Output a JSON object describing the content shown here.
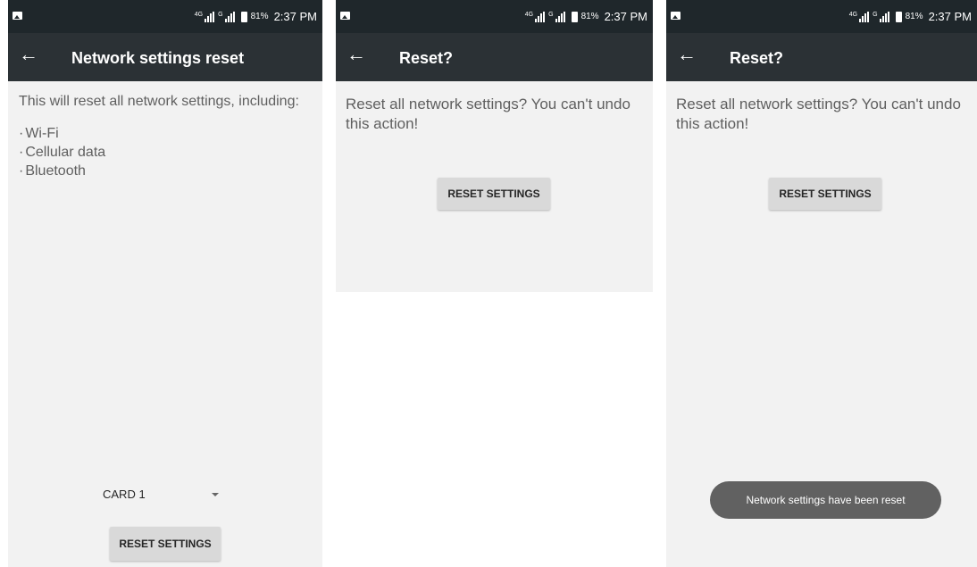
{
  "status_bar": {
    "battery_percent": "81%",
    "time": "2:37 PM",
    "signal_tag_1": "4G",
    "signal_tag_2": "G"
  },
  "screen1": {
    "title": "Network settings reset",
    "description": "This will reset all network settings, including:",
    "items": [
      "Wi-Fi",
      "Cellular data",
      "Bluetooth"
    ],
    "card_select_value": "CARD 1",
    "button_label": "RESET SETTINGS"
  },
  "screen2": {
    "title": "Reset?",
    "message": "Reset all network settings? You can't undo this action!",
    "button_label": "RESET SETTINGS"
  },
  "screen3": {
    "title": "Reset?",
    "message": "Reset all network settings? You can't undo this action!",
    "button_label": "RESET SETTINGS",
    "toast": "Network settings have been reset"
  },
  "colors": {
    "status_bar": "#1f272b",
    "app_bar": "#2b3135",
    "background": "#f2f2f2",
    "button": "#d9d9d9",
    "toast": "#616161"
  },
  "icons": [
    "image-icon",
    "signal-icon",
    "battery-icon",
    "back-arrow-icon",
    "dropdown-arrow-icon"
  ]
}
